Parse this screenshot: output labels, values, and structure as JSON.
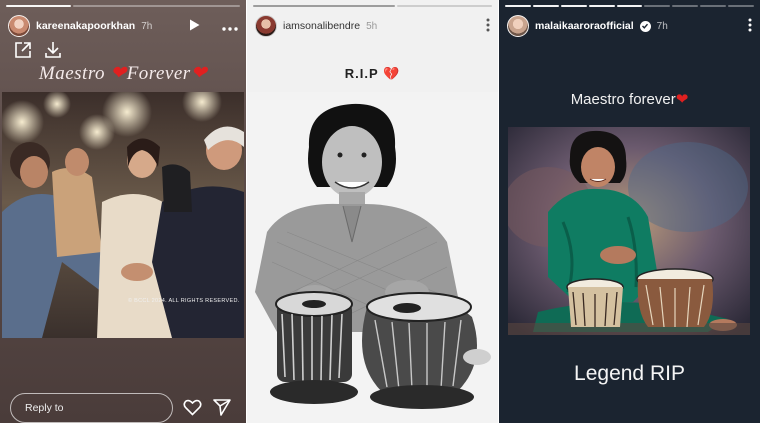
{
  "stories": [
    {
      "username": "kareenakapoorkhan",
      "time": "7h",
      "caption_text": "Maestro ",
      "caption_text_2": "Forever",
      "photo_credit": "© BCCL 2024. ALL RIGHTS RESERVED.",
      "reply_placeholder": "Reply to",
      "icons": [
        "play-icon",
        "more-icon",
        "external-link-icon",
        "download-icon",
        "heart-icon",
        "send-icon"
      ]
    },
    {
      "username": "iamsonalibendre",
      "time": "5h",
      "caption_text": "R.I.P",
      "icons": [
        "more-vertical-icon",
        "broken-heart-icon"
      ]
    },
    {
      "username": "malaikaaroraofficial",
      "time": "7h",
      "caption_text": "Maestro forever",
      "caption_text_2": "Legend RIP",
      "icons": [
        "verified-icon",
        "more-vertical-icon",
        "heart-icon"
      ]
    }
  ],
  "colors": {
    "heart": "#e02020",
    "story3_background": "#1b2430",
    "story2_background": "#f1f1f1"
  }
}
